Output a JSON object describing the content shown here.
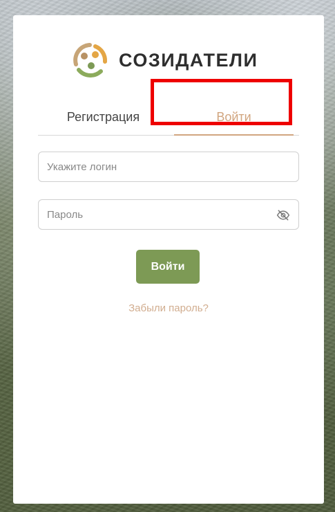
{
  "brand": {
    "name": "СОЗИДАТЕЛИ",
    "logo_icon": "people-circle-logo",
    "colors": {
      "green": "#7d9a55",
      "gold": "#d1a57f",
      "orange": "#e2a54a"
    }
  },
  "tabs": [
    {
      "label": "Регистрация",
      "active": false
    },
    {
      "label": "Войти",
      "active": true
    }
  ],
  "form": {
    "login_placeholder": "Укажите логин",
    "login_value": "",
    "password_placeholder": "Пароль",
    "password_value": "",
    "password_toggle_icon": "eye-off-icon",
    "submit_label": "Войти",
    "forgot_link": "Забыли пароль?"
  },
  "annotation": {
    "highlight_color": "#ee0000"
  }
}
